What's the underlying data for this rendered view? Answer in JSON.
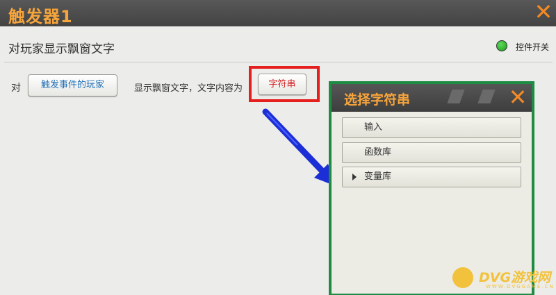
{
  "window": {
    "title": "触发器1",
    "close_icon": "close-x-icon"
  },
  "header": {
    "heading": "对玩家显示飘窗文字",
    "toggle_label": "控件开关",
    "toggle_color": "#2db02a"
  },
  "action_row": {
    "prefix": "对",
    "target_button": "触发事件的玩家",
    "description": "显示飘窗文字，文字内容为",
    "string_button": "字符串",
    "highlight_color": "#e51e1e"
  },
  "picker": {
    "title": "选择字符串",
    "border_color": "#1e8c42",
    "items": [
      {
        "label": "输入"
      },
      {
        "label": "函数库"
      },
      {
        "label": "变量库",
        "has_caret": true
      }
    ]
  },
  "watermark": {
    "text": "DVG游戏网",
    "sub": "WWW.DVGGAME.CN"
  }
}
